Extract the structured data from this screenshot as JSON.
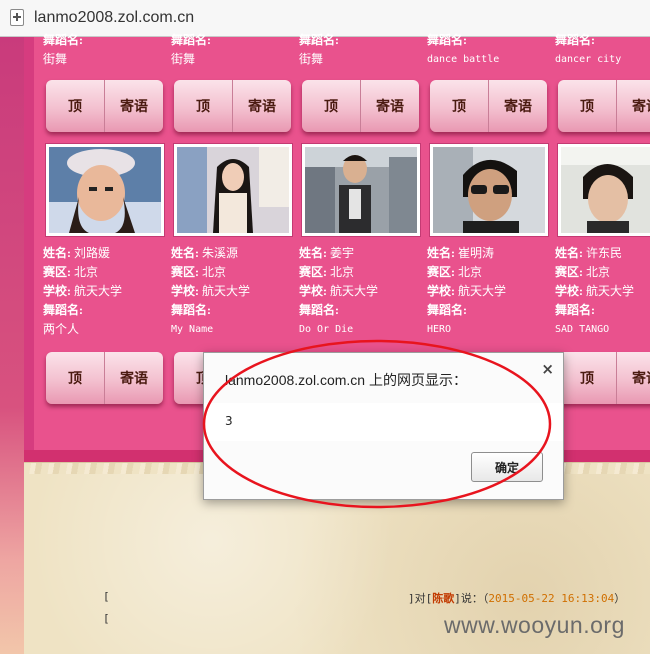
{
  "address_bar": {
    "url": "lanmo2008.zol.com.cn"
  },
  "labels": {
    "name": "姓名:",
    "region": "赛区:",
    "school": "学校:",
    "dance": "舞蹈名:"
  },
  "buttons": {
    "top": "顶",
    "message": "寄语"
  },
  "row1": [
    {
      "dance": "街舞"
    },
    {
      "dance": "街舞"
    },
    {
      "dance": "街舞"
    },
    {
      "dance": "dance battle"
    },
    {
      "dance": "dancer city"
    }
  ],
  "row2": [
    {
      "name": "刘路媛",
      "region": "北京",
      "school": "航天大学",
      "dance": "两个人"
    },
    {
      "name": "朱溪源",
      "region": "北京",
      "school": "航天大学",
      "dance": "My Name"
    },
    {
      "name": "姜宇",
      "region": "北京",
      "school": "航天大学",
      "dance": "Do Or Die"
    },
    {
      "name": "崔明涛",
      "region": "北京",
      "school": "航天大学",
      "dance": "HERO"
    },
    {
      "name": "许东民",
      "region": "北京",
      "school": "航天大学",
      "dance": "SAD TANGO"
    }
  ],
  "dialog": {
    "title": "lanmo2008.zol.com.cn 上的网页显示：",
    "message": "3",
    "ok_label": "确定",
    "close_glyph": "×"
  },
  "comments": [
    {
      "open": "[",
      "prefix": "]对[",
      "user": "陈歌",
      "suffix": "]说：（",
      "time": "2015-05-22 16:13:04",
      "close": "）"
    },
    {
      "open": "["
    }
  ],
  "watermark": "www.wooyun.org",
  "colors": {
    "page_pink": "#e9528d",
    "annotation_red": "#e8141e",
    "button_text": "#4a1a10"
  }
}
